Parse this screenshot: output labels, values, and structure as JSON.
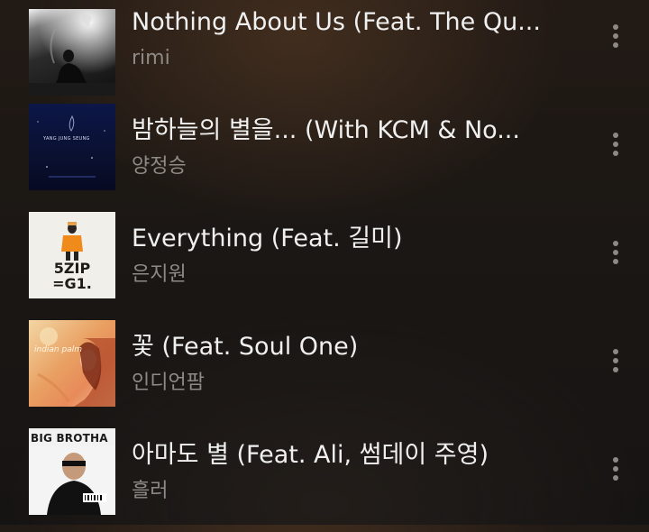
{
  "tracks": [
    {
      "title": "Nothing About Us (Feat. The Qu...",
      "artist": "rimi",
      "art_icon": "album-art-dark-figure",
      "art_text": ""
    },
    {
      "title": "밤하늘의 별을... (With KCM & No...",
      "artist": "양정승",
      "art_icon": "album-art-navy-title",
      "art_text": "YANG JUNG SEUNG"
    },
    {
      "title": "Everything (Feat. 길미)",
      "artist": "은지원",
      "art_icon": "album-art-5zip-g1",
      "art_text": "5ZIP =G1."
    },
    {
      "title": "꽃 (Feat. Soul One)",
      "artist": "인디언팜",
      "art_icon": "album-art-indian-palm",
      "art_text": "indian palm"
    },
    {
      "title": "아마도 별 (Feat. Ali, 썸데이 주영)",
      "artist": "흘러",
      "art_icon": "album-art-big-brotha",
      "art_text": "BIG BROTHA"
    }
  ],
  "more_icon": "more-vertical-icon",
  "colors": {
    "title": "#f0f0f0",
    "artist": "#8e8a86",
    "menu_dots": "#8d8985"
  }
}
